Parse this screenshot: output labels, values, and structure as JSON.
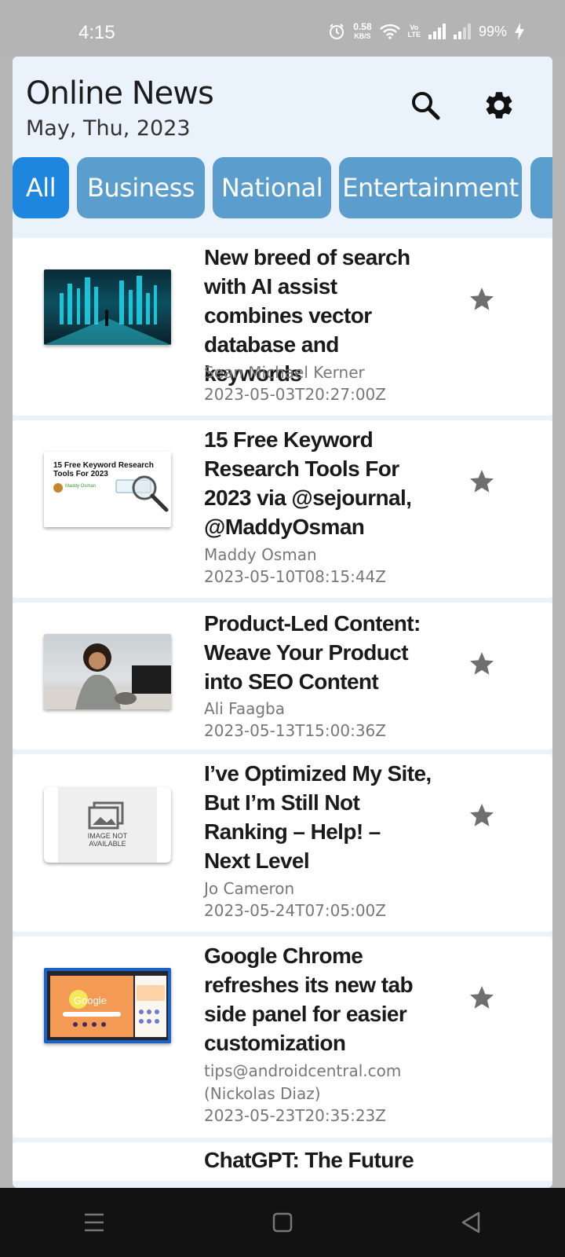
{
  "status_bar": {
    "time": "4:15",
    "net_speed": "0.58",
    "net_unit": "KB/S",
    "volte_1": "Vo",
    "volte_2": "LTE",
    "battery": "99%",
    "icons": [
      "alarm-icon",
      "wifi-icon",
      "volte-icon",
      "signal-icon",
      "signal-icon",
      "charging-icon"
    ]
  },
  "header": {
    "title": "Online News",
    "date": "May, Thu, 2023",
    "actions": [
      "search-icon",
      "gear-icon"
    ]
  },
  "tabs": [
    {
      "label": "All",
      "active": true
    },
    {
      "label": "Business",
      "active": false
    },
    {
      "label": "National",
      "active": false
    },
    {
      "label": "Entertainment",
      "active": false
    }
  ],
  "articles": [
    {
      "title": "New breed of search with AI assist combines vector database and keywords",
      "author": "Sean Michael Kerner",
      "date": "2023-05-03T20:27:00Z",
      "starred": false
    },
    {
      "title": "15 Free Keyword Research Tools For 2023 via @sejournal, @MaddyOsman",
      "author": "Maddy Osman",
      "date": "2023-05-10T08:15:44Z",
      "starred": false,
      "thumb_text": "15 Free Keyword Research Tools For 2023",
      "thumb_caption": "Maddy Osman"
    },
    {
      "title": "Product-Led Content: Weave Your Product into SEO Content",
      "author": "Ali Faagba",
      "date": "2023-05-13T15:00:36Z",
      "starred": false
    },
    {
      "title": "I’ve Optimized My Site, But I’m Still Not Ranking – Help! – Next Level",
      "author": "Jo Cameron",
      "date": "2023-05-24T07:05:00Z",
      "starred": false,
      "thumb_text": "IMAGE NOT AVAILABLE"
    },
    {
      "title": "Google Chrome refreshes its new tab side panel for easier customization",
      "author": "tips@androidcentral.com (Nickolas Diaz)",
      "date": "2023-05-23T20:35:23Z",
      "starred": false,
      "thumb_text": "Google"
    },
    {
      "title": "ChatGPT: The Future of",
      "author": "",
      "date": "",
      "starred": false
    }
  ],
  "colors": {
    "tab_active": "#1f86e0",
    "tab_inactive": "#5b9dcc",
    "star": "#6f6f6f",
    "app_bg": "#eaf2fb"
  },
  "nav_bar": [
    "menu-icon",
    "home-icon",
    "back-icon"
  ]
}
